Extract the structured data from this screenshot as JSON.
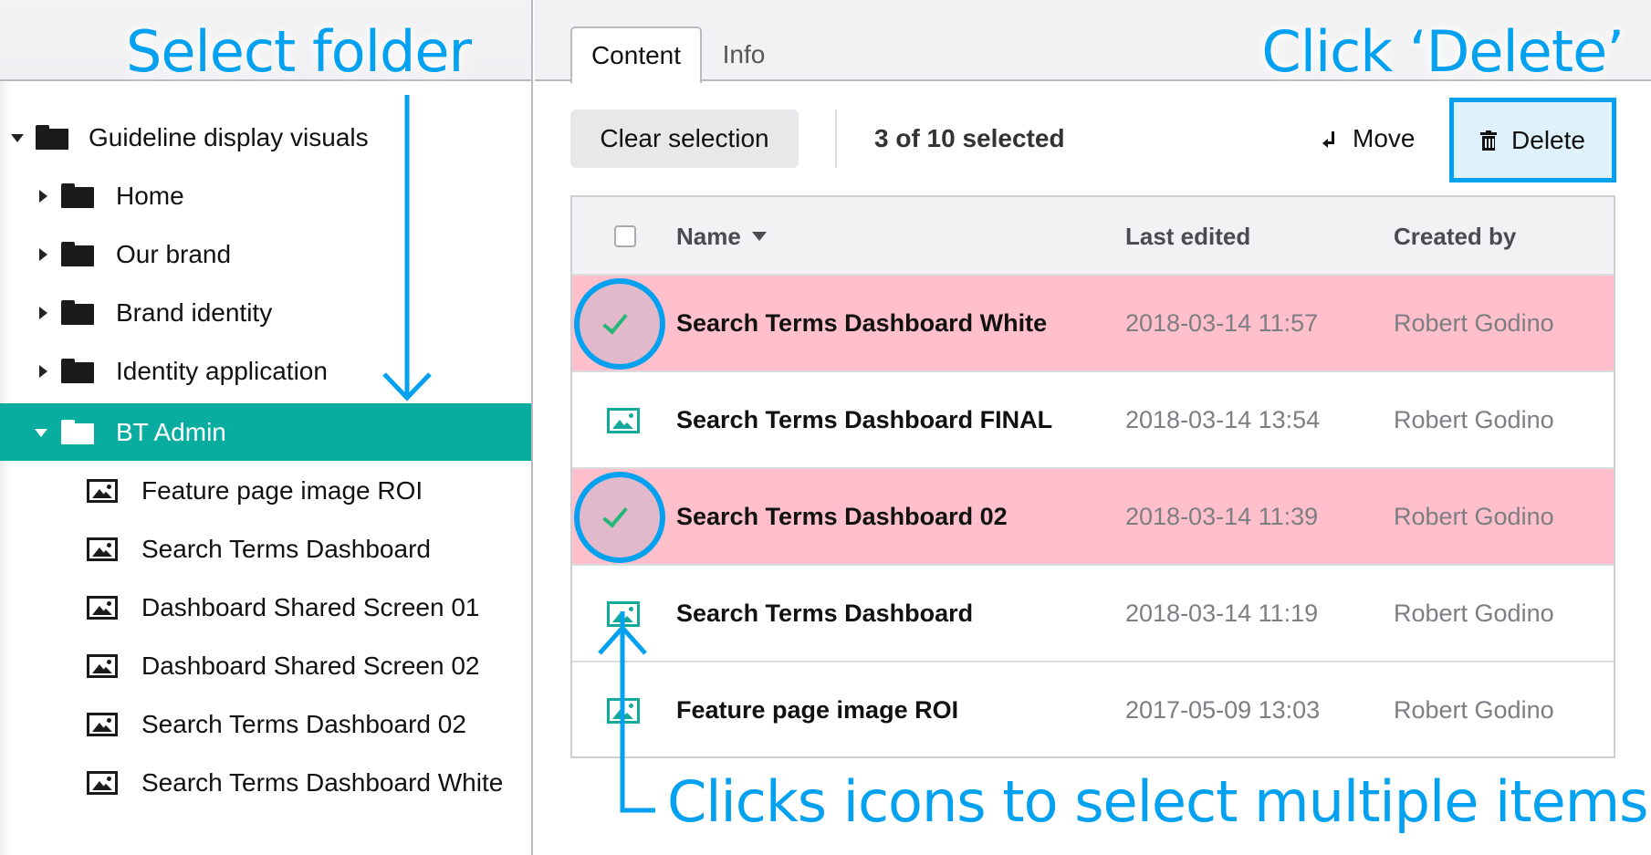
{
  "sidebar": {
    "tree": [
      {
        "label": "Guideline display visuals",
        "type": "folder",
        "expanded": true,
        "level": 0
      },
      {
        "label": "Home",
        "type": "folder",
        "expanded": false,
        "level": 1
      },
      {
        "label": "Our brand",
        "type": "folder",
        "expanded": false,
        "level": 1
      },
      {
        "label": "Brand identity",
        "type": "folder",
        "expanded": false,
        "level": 1
      },
      {
        "label": "Identity application",
        "type": "folder",
        "expanded": false,
        "level": 1
      },
      {
        "label": "BT Admin",
        "type": "folder",
        "expanded": true,
        "selected": true,
        "level": 1
      },
      {
        "label": "Feature page image ROI",
        "type": "image",
        "level": 2
      },
      {
        "label": "Search Terms Dashboard",
        "type": "image",
        "level": 2
      },
      {
        "label": "Dashboard Shared Screen 01",
        "type": "image",
        "level": 2
      },
      {
        "label": "Dashboard Shared Screen 02",
        "type": "image",
        "level": 2
      },
      {
        "label": "Search Terms Dashboard 02",
        "type": "image",
        "level": 2
      },
      {
        "label": "Search Terms Dashboard White",
        "type": "image",
        "level": 2
      }
    ]
  },
  "tabs": [
    {
      "label": "Content",
      "active": true
    },
    {
      "label": "Info",
      "active": false
    }
  ],
  "toolbar": {
    "clear_selection_label": "Clear selection",
    "selected_count": "3 of 10 selected",
    "move_label": "Move",
    "delete_label": "Delete"
  },
  "table": {
    "columns": [
      "Name",
      "Last edited",
      "Created by"
    ],
    "sort_column": "Name",
    "rows": [
      {
        "name": "Search Terms Dashboard White",
        "last_edited": "2018-03-14 11:57",
        "created_by": "Robert Godino",
        "selected": true
      },
      {
        "name": "Search Terms Dashboard FINAL",
        "last_edited": "2018-03-14 13:54",
        "created_by": "Robert Godino",
        "selected": false
      },
      {
        "name": "Search Terms Dashboard 02",
        "last_edited": "2018-03-14 11:39",
        "created_by": "Robert Godino",
        "selected": true
      },
      {
        "name": "Search Terms Dashboard",
        "last_edited": "2018-03-14 11:19",
        "created_by": "Robert Godino",
        "selected": false
      },
      {
        "name": "Feature page image ROI",
        "last_edited": "2017-05-09 13:03",
        "created_by": "Robert Godino",
        "selected": false
      }
    ]
  },
  "annotations": {
    "select_folder": "Select folder",
    "click_delete": "Click ‘Delete’",
    "click_icons": "Clicks icons to select multiple items"
  },
  "colors": {
    "accent_teal": "#08ada0",
    "annotation_blue": "#03a1ef",
    "selected_row": "#ffc0cb",
    "delete_highlight": "#dff2fc",
    "check_green": "#25b67a"
  }
}
